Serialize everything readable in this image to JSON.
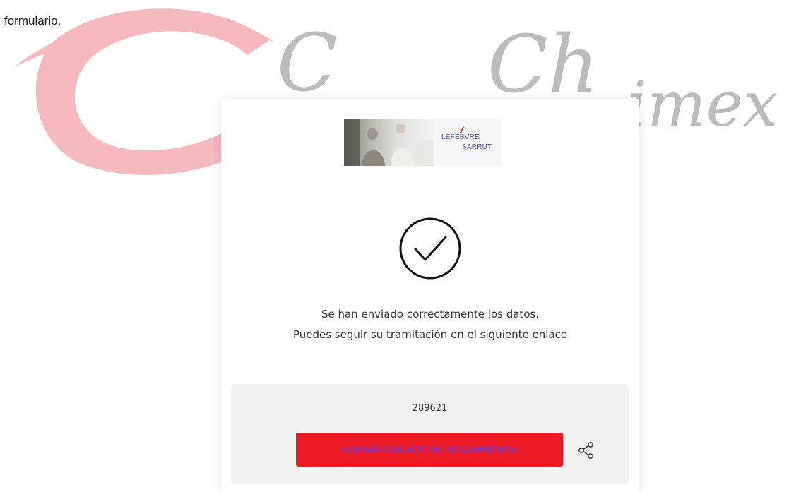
{
  "document": {
    "text": "formulario."
  },
  "watermark": {
    "letters": [
      "C",
      "Ch",
      "imex"
    ],
    "logo_color": "#f5b8bd",
    "text_color": "#b4b4b4"
  },
  "card": {
    "banner": {
      "brand_line1": "LEFEBVRE",
      "brand_line2": "SARRUT"
    },
    "success_icon": "check-circle-icon",
    "message_line1": "Se han enviado correctamente los datos.",
    "message_line2": "Puedes seguir su tramitación en el siguiente enlace",
    "tracking": {
      "code": "289621",
      "copy_button_label": "COPIAR ENLACE DE SEGUIMIENTO",
      "share_icon": "share-icon"
    }
  },
  "colors": {
    "button_bg": "#ee1b24",
    "button_text": "#6b39d9",
    "brand_blue": "#3e4a93",
    "panel_bg": "#f2f2f2"
  }
}
